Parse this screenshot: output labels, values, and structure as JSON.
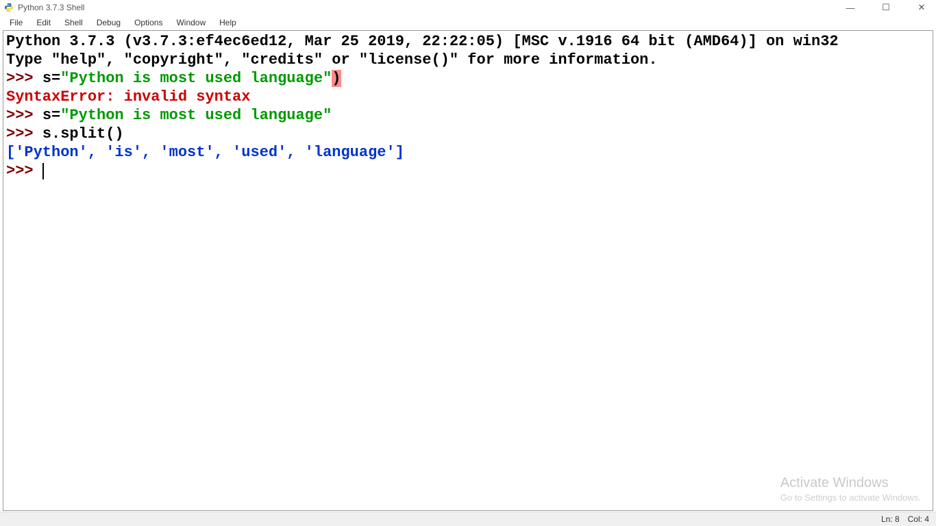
{
  "window": {
    "title": "Python 3.7.3 Shell",
    "controls": {
      "minimize": "—",
      "maximize": "☐",
      "close": "✕"
    }
  },
  "menu": {
    "items": [
      "File",
      "Edit",
      "Shell",
      "Debug",
      "Options",
      "Window",
      "Help"
    ]
  },
  "shell": {
    "banner_line1": "Python 3.7.3 (v3.7.3:ef4ec6ed12, Mar 25 2019, 22:22:05) [MSC v.1916 64 bit (AMD64)] on win32",
    "banner_line2": "Type \"help\", \"copyright\", \"credits\" or \"license()\" for more information.",
    "prompt": ">>> ",
    "line1_code": "s=",
    "line1_string": "\"Python is most used language\"",
    "line1_trail": ")",
    "error_text": "SyntaxError: invalid syntax",
    "line2_code": "s=",
    "line2_string": "\"Python is most used language\"",
    "line3_code": "s.split()",
    "output_text": "['Python', 'is', 'most', 'used', 'language']",
    "final_prompt": ">>> "
  },
  "status": {
    "ln": "Ln: 8",
    "col": "Col: 4"
  },
  "watermark": {
    "line1": "Activate Windows",
    "line2": "Go to Settings to activate Windows."
  }
}
